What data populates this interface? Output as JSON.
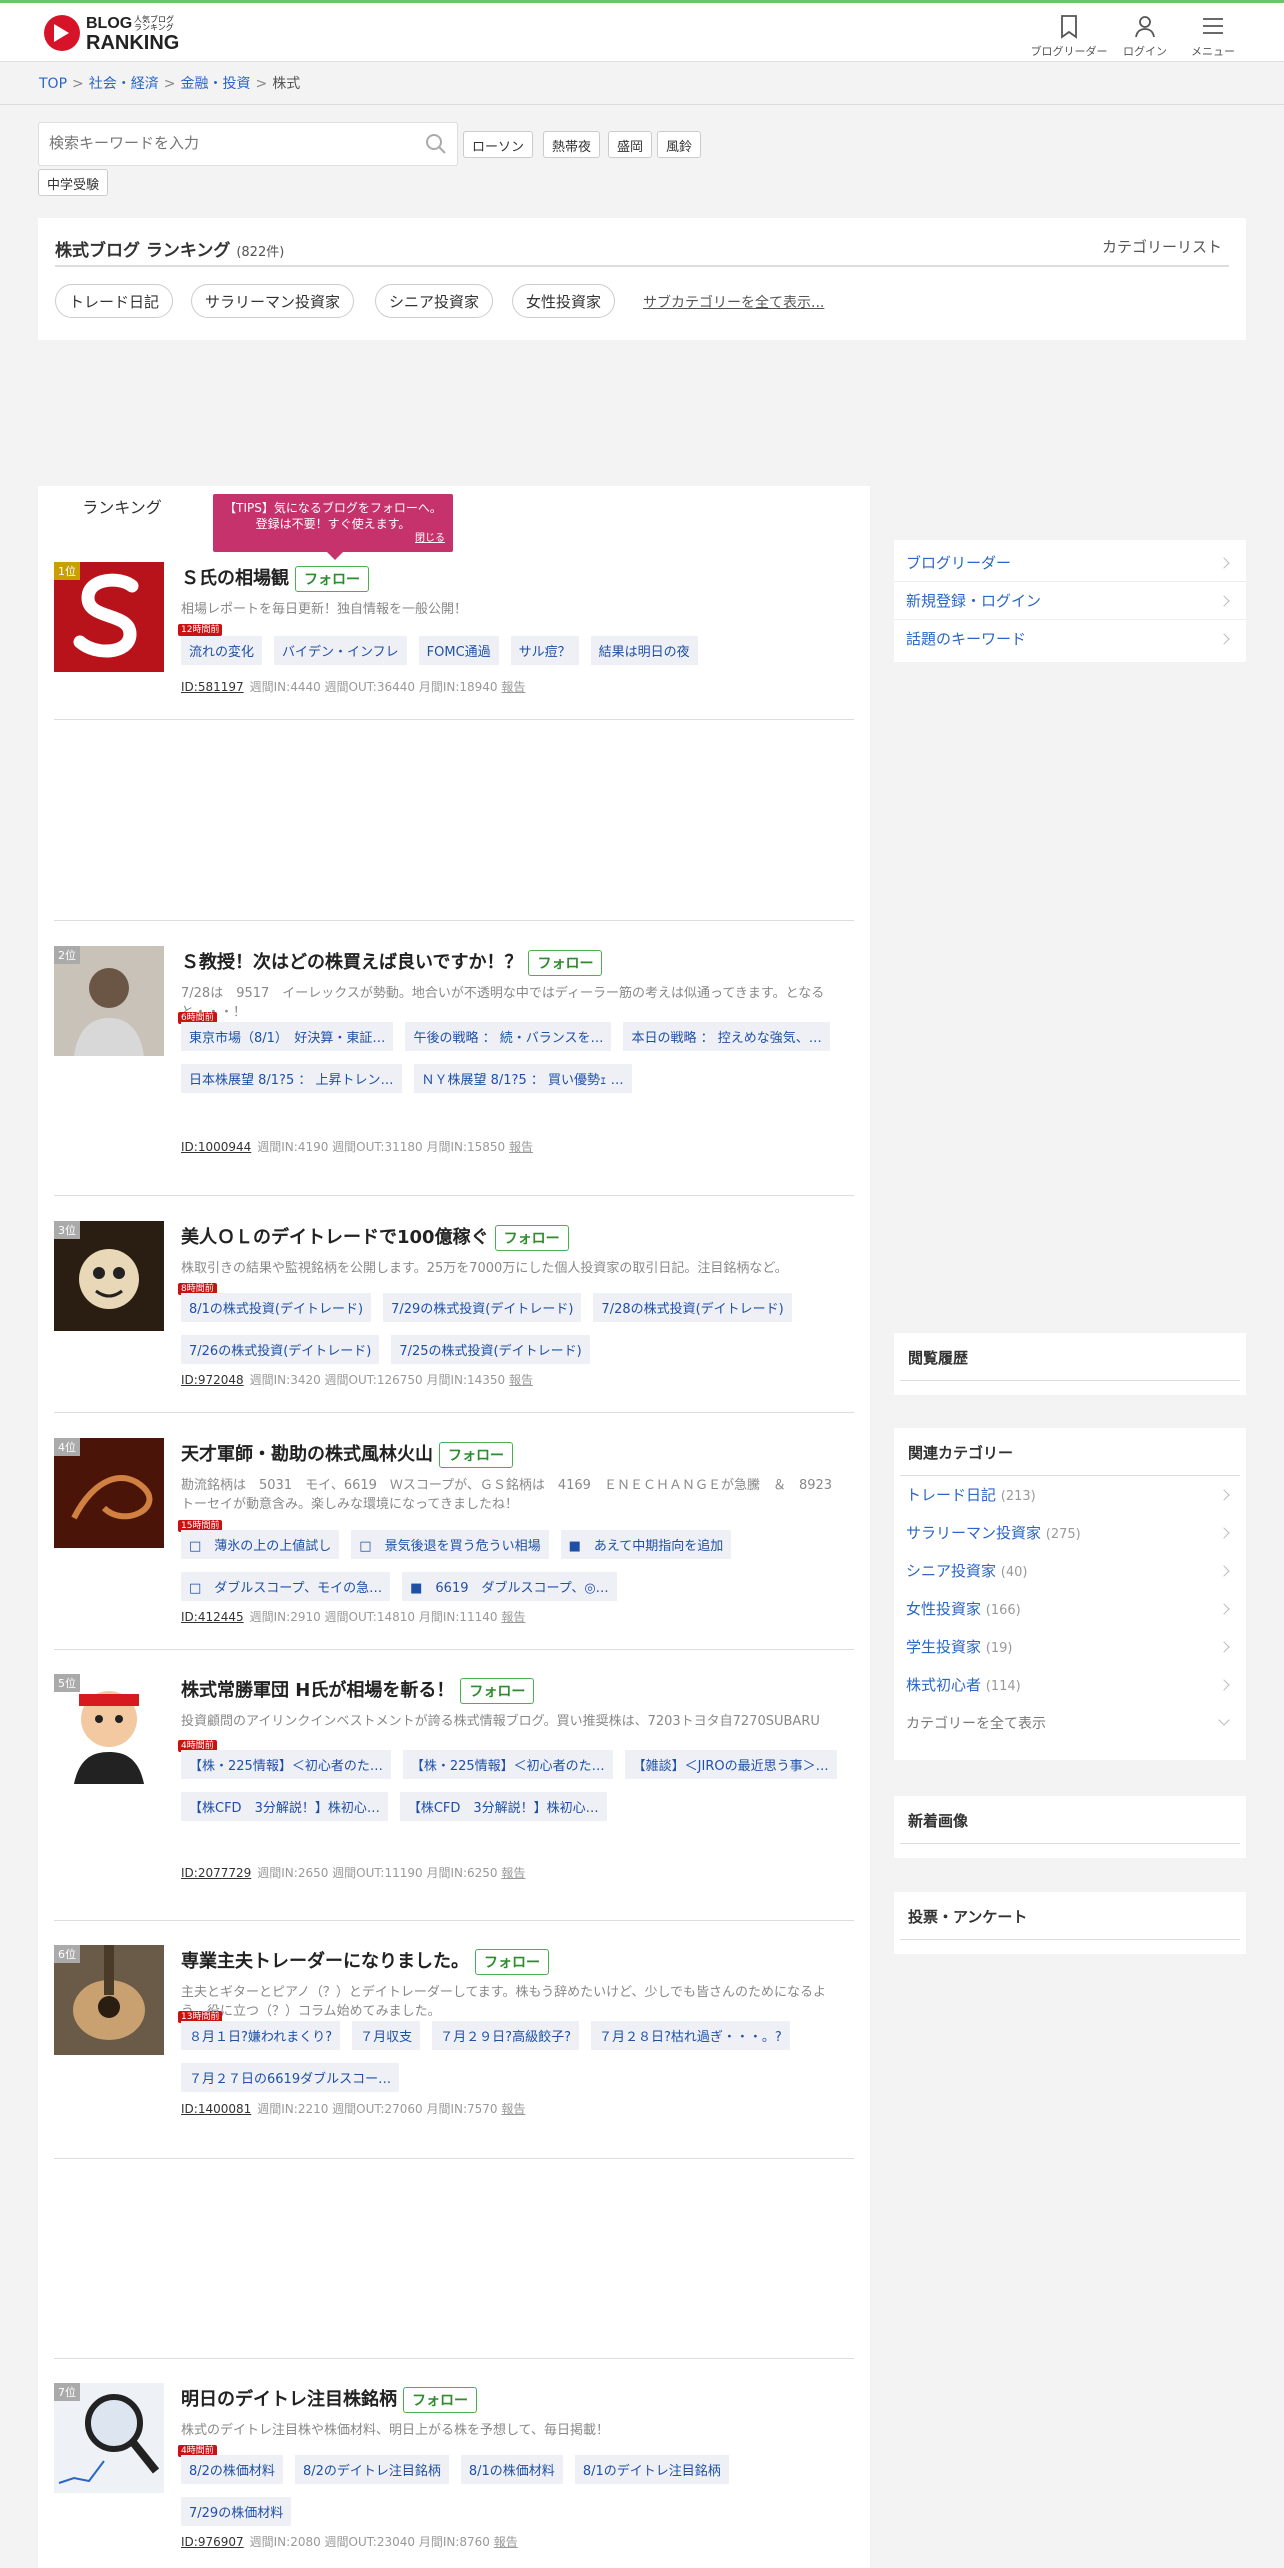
{
  "header": {
    "logo_line1": "BLOG",
    "logo_line2": "RANKING",
    "logo_small": "人気ブログランキング",
    "icons": [
      {
        "name": "bookmark-icon",
        "label": "ブログリーダー"
      },
      {
        "name": "user-icon",
        "label": "ログイン"
      },
      {
        "name": "menu-icon",
        "label": "メニュー"
      }
    ]
  },
  "breadcrumb": [
    "TOP",
    "社会・経済",
    "金融・投資",
    "株式"
  ],
  "search": {
    "placeholder": "検索キーワードを入力",
    "keywords": [
      "ローソン",
      "熱帯夜",
      "盛岡",
      "風鈴",
      "中学受験"
    ]
  },
  "category": {
    "title": "株式ブログ ランキング",
    "count": "(822件)",
    "list_link": "カテゴリーリスト",
    "subcategories": [
      "トレード日記",
      "サラリーマン投資家",
      "シニア投資家",
      "女性投資家"
    ],
    "all_subcategories": "サブカテゴリーを全て表示..."
  },
  "tab_label": "ランキング",
  "tip": {
    "text": "【TIPS】気になるブログをフォローへ。登録は不要！すぐ使えます。",
    "close": "閉じる"
  },
  "follow_label": "フォロー",
  "entries": [
    {
      "rank": "1位",
      "title": "Ｓ氏の相場観",
      "desc": "相場レポートを毎日更新！独自情報を一般公開！",
      "badge": "12時間前",
      "tags": [
        "流れの変化",
        "バイデン・インフレ",
        "FOMC通過",
        "サル痘？",
        "結果は明日の夜"
      ],
      "id": "ID:581197",
      "stats": "週間IN:4440 週間OUT:36440 月間IN:18940",
      "report": "報告",
      "thumb_color": "#b8131b"
    },
    {
      "rank": "2位",
      "title": "Ｓ教授！次はどの株買えば良いですか！？",
      "desc": "7/28は　9517　イーレックスが勢動。地合いが不透明な中ではディーラー筋の考えは似通ってきます。となると・・・！",
      "badge": "6時間前",
      "tags": [
        "東京市場（8/1）　好決算・東証…",
        "午後の戦略 ： 続・バランスを…",
        "本日の戦略 ： 控えめな強気、…",
        "日本株展望 8/1?5 ： 上昇トレン…",
        "ＮＹ株展望 8/1?5 ： 買い優勢ｪ …"
      ],
      "id": "ID:1000944",
      "stats": "週間IN:4190 週間OUT:31180 月間IN:15850",
      "report": "報告",
      "thumb_color": "#8a7a6a"
    },
    {
      "rank": "3位",
      "title": "美人ＯＬのデイトレードで100億稼ぐ",
      "desc": "株取引きの結果や監視銘柄を公開します。25万を7000万にした個人投資家の取引日記。注目銘柄など。",
      "badge": "8時間前",
      "tags": [
        "8/1の株式投資(デイトレード)",
        "7/29の株式投資(デイトレード)",
        "7/28の株式投資(デイトレード)",
        "7/26の株式投資(デイトレード)",
        "7/25の株式投資(デイトレード)"
      ],
      "id": "ID:972048",
      "stats": "週間IN:3420 週間OUT:126750 月間IN:14350",
      "report": "報告",
      "thumb_color": "#3a2a1a"
    },
    {
      "rank": "4位",
      "title": "天才軍師・勘助の株式風林火山",
      "desc": "勘流銘柄は　5031　モイ、6619　Ｗスコープが、ＧＳ銘柄は　4169　ＥＮＥＣＨＡＮＧＥが急騰　＆　8923　トーセイが動意含み。楽しみな環境になってきましたね！",
      "badge": "15時間前",
      "tags": [
        "□　薄氷の上の上値試し",
        "□　景気後退を買う危うい相場",
        "■　あえて中期指向を追加",
        "□　ダブルスコープ、モイの急…",
        "■　6619　ダブルスコープ、◎…"
      ],
      "id": "ID:412445",
      "stats": "週間IN:2910 週間OUT:14810 月間IN:11140",
      "report": "報告",
      "thumb_color": "#5a1a10"
    },
    {
      "rank": "5位",
      "title": "株式常勝軍団 H氏が相場を斬る！",
      "desc": "投資顧問のアイリンクインベストメントが誇る株式情報ブログ。買い推奨株は、7203トヨタ自7270SUBARU",
      "badge": "4時間前",
      "tags": [
        "【株・225情報】＜初心者のた…",
        "【株・225情報】＜初心者のた…",
        "【雑談】＜JIROの最近思う事＞…",
        "【株CFD　3分解説！】株初心…",
        "【株CFD　3分解説！】株初心…"
      ],
      "id": "ID:2077729",
      "stats": "週間IN:2650 週間OUT:11190 月間IN:6250",
      "report": "報告",
      "thumb_color": "#f5f5f5"
    },
    {
      "rank": "6位",
      "title": "専業主夫トレーダーになりました。",
      "desc": "主夫とギターとピアノ（？）とデイトレーダーしてます。株もう辞めたいけど、少しでも皆さんのためになるよう、役に立つ（？）コラム始めてみました。",
      "badge": "13時間前",
      "tags": [
        "８月１日?嫌われまくり?",
        "７月収支",
        "７月２９日?高級餃子?",
        "７月２８日?枯れ過ぎ・・・。?",
        "７月２７日の6619ダブルスコー…"
      ],
      "id": "ID:1400081",
      "stats": "週間IN:2210 週間OUT:27060 月間IN:7570",
      "report": "報告",
      "thumb_color": "#7a6a55"
    },
    {
      "rank": "7位",
      "title": "明日のデイトレ注目株銘柄",
      "desc": "株式のデイトレ注目株や株価材料、明日上がる株を予想して、毎日掲載！",
      "badge": "4時間前",
      "tags": [
        "8/2の株価材料",
        "8/2のデイトレ注目銘柄",
        "8/1の株価材料",
        "8/1のデイトレ注目銘柄",
        "7/29の株価材料"
      ],
      "id": "ID:976907",
      "stats": "週間IN:2080 週間OUT:23040 月間IN:8760",
      "report": "報告",
      "thumb_color": "#e8eef5"
    }
  ],
  "sidebar": {
    "links": [
      "ブログリーダー",
      "新規登録・ログイン",
      "話題のキーワード"
    ],
    "history_title": "閲覧履歴",
    "related_title": "関連カテゴリー",
    "related": [
      {
        "name": "トレード日記",
        "count": "(213)"
      },
      {
        "name": "サラリーマン投資家",
        "count": "(275)"
      },
      {
        "name": "シニア投資家",
        "count": "(40)"
      },
      {
        "name": "女性投資家",
        "count": "(166)"
      },
      {
        "name": "学生投資家",
        "count": "(19)"
      },
      {
        "name": "株式初心者",
        "count": "(114)"
      }
    ],
    "related_all": "カテゴリーを全て表示",
    "new_images_title": "新着画像",
    "vote_title": "投票・アンケート"
  }
}
